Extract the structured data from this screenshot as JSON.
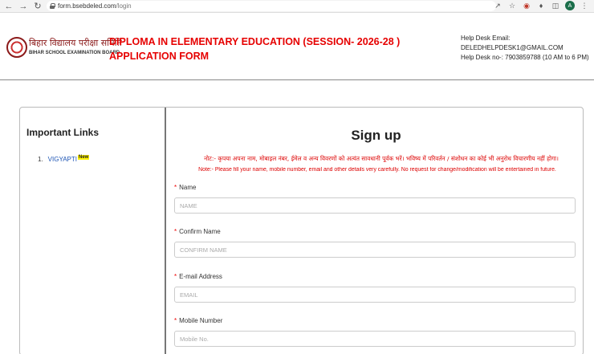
{
  "browser": {
    "url_host": "form.bsebdeled.com",
    "url_path": "/login",
    "avatar_letter": "A"
  },
  "header": {
    "logo_hindi": "बिहार विद्यालय परीक्षा समिति",
    "logo_english": "BIHAR SCHOOL EXAMINATION BOARD",
    "title": "DIPLOMA IN ELEMENTARY EDUCATION (SESSION- 2026-28 ) APPLICATION FORM",
    "help_email_label": "Help Desk Email:",
    "help_email": "DELEDHELPDESK1@GMAIL.COM",
    "help_phone": "Help Desk no-: 7903859788 (10 AM to 6 PM)"
  },
  "links": {
    "title": "Important Links",
    "items": [
      {
        "num": "1.",
        "label": "VIGYAPTI",
        "badge": "New"
      }
    ]
  },
  "form": {
    "title": "Sign up",
    "note_hindi": "नोट:- कृपया अपना नाम, मोबाइल नंबर, ईमेल व अन्य विवरणों को अत्यंत सावधानी पूर्वक भरें। भविष्य में परिवर्तन / संशोधन का कोई भी अनुरोध विचारणीय नहीं होगा।",
    "note_english": "Note:- Please fill your name, mobile number, email and other details very carefully. No request for change/modification will be entertained in future.",
    "required_mark": "*",
    "fields": [
      {
        "label": "Name",
        "placeholder": "NAME"
      },
      {
        "label": "Confirm Name",
        "placeholder": "CONFIRM NAME"
      },
      {
        "label": "E-mail Address",
        "placeholder": "EMAIL"
      },
      {
        "label": "Mobile Number",
        "placeholder": "Mobile No."
      }
    ]
  },
  "colors": {
    "title_red": "#e60000",
    "link_blue": "#1f56b5",
    "badge_yellow": "#fff200"
  }
}
